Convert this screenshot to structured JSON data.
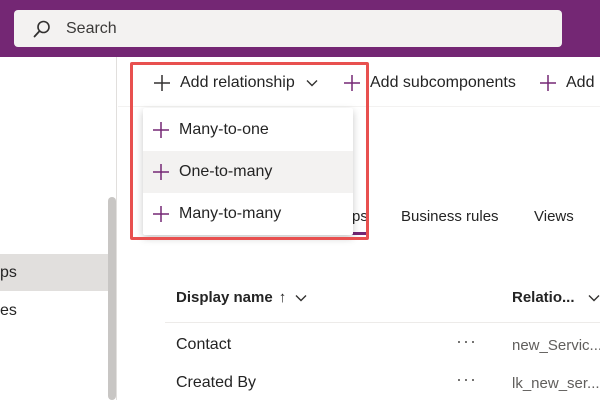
{
  "colors": {
    "header": "#742774",
    "accent": "#742774",
    "highlight": "#e8504f",
    "selected_nav": "#e1dfdd"
  },
  "search": {
    "placeholder": "Search",
    "icon": "search-icon"
  },
  "leftnav": {
    "items": [
      {
        "label": "ps",
        "selected": true
      },
      {
        "label": "es",
        "selected": false
      }
    ]
  },
  "commandbar": {
    "add_relationship": "Add relationship",
    "add_subcomponents": "Add subcomponents",
    "add_truncated": "Add"
  },
  "dropdown": {
    "items": [
      {
        "label": "Many-to-one"
      },
      {
        "label": "One-to-many"
      },
      {
        "label": "Many-to-many"
      }
    ]
  },
  "tabs": [
    {
      "label": "ps",
      "active": true
    },
    {
      "label": "Business rules",
      "active": false
    },
    {
      "label": "Views",
      "active": false
    }
  ],
  "table": {
    "columns": {
      "display_name": "Display name",
      "sort_arrow": "↑",
      "relationship": "Relatio..."
    },
    "rows": [
      {
        "display_name": "Contact",
        "actions": "···",
        "relationship": "new_Servic..."
      },
      {
        "display_name": "Created By",
        "actions": "···",
        "relationship": "lk_new_ser..."
      }
    ]
  }
}
